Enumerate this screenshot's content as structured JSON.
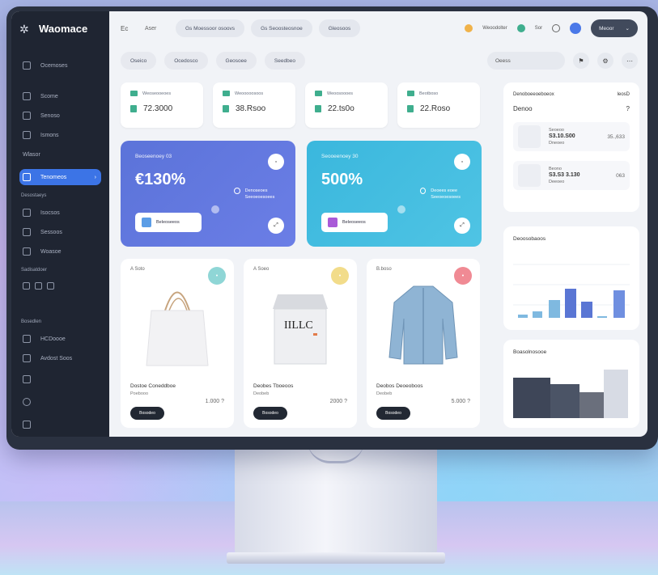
{
  "sidebar": {
    "brand": "Waomace",
    "items": [
      {
        "label": "Ocemoses"
      },
      {
        "label": "Scome"
      },
      {
        "label": "Senoso"
      },
      {
        "label": "Ismons"
      },
      {
        "label": "Wlasor"
      }
    ],
    "active_label": "Tenomeos",
    "section_1": "Desostaeys",
    "section_1_items": [
      {
        "label": "Isocsos"
      },
      {
        "label": "Sessoos"
      },
      {
        "label": "Woasoe"
      }
    ],
    "section_2": "Sadisatdoer",
    "section_3": "Bosedlen",
    "section_3_items": [
      {
        "label": "HCDoooe"
      },
      {
        "label": "Avdost Soos"
      }
    ]
  },
  "topbar": {
    "logo": "Ec",
    "title": "Aser",
    "pills": [
      "Gs Moessoor osoovs",
      "Gs Seoosteosnoe",
      "Gleosoos"
    ],
    "right_items": [
      "Weoodolter",
      "Sor"
    ],
    "user": "Meoor"
  },
  "subbar": {
    "pills": [
      "Oseico",
      "Ocedosco",
      "Geosoee",
      "Seedbeo"
    ],
    "search_placeholder": "Oeess"
  },
  "stats": [
    {
      "label": "Weoseooeoes",
      "value": "72.3000"
    },
    {
      "label": "Weooooosoos",
      "value": "38.Rsoo"
    },
    {
      "label": "Weoosoooes",
      "value": "22.ts0o"
    },
    {
      "label": "Beotboso",
      "value": "22.Roso"
    }
  ],
  "hero": [
    {
      "label": "Beoseenoey 03",
      "value": "€130%",
      "mid": "Denoseoes  Seeoeoesoees",
      "button": "Beleoseeos"
    },
    {
      "label": "Seooeenoey 30",
      "value": "500%",
      "mid": "Deoees eoee  Seeoeoesoees",
      "button": "Beleoseeos"
    }
  ],
  "products": [
    {
      "tag": "A Soto",
      "name": "Dostoe Coneddboe",
      "sub": "Poebooo",
      "price": "1.000 ?",
      "button": "Bosodeo",
      "dot_color": "#8fd6d6"
    },
    {
      "tag": "A Soeo",
      "name": "Deobes Tboeoos",
      "sub": "Deobeb",
      "price": "2000 ?",
      "button": "Bosodeo",
      "dot_color": "#f2dc8a"
    },
    {
      "tag": "B.boso",
      "name": "Deobos Deoeoboos",
      "sub": "Deobeb",
      "price": "5.000 ?",
      "button": "Bosodeo",
      "dot_color": "#f08a94"
    }
  ],
  "right_panel": {
    "title": "Denoboeeoeboeox",
    "title_right": "leosD",
    "subtitle": "Denoo",
    "subtitle_right": "?",
    "orders": [
      {
        "head": "Seoeoo",
        "main": "S3.10.S00",
        "sub": "Dneoeo",
        "amount": "35.,633"
      },
      {
        "head": "Beono",
        "main": "S3.S3 3.130",
        "sub": "Deeoeo",
        "amount": "063"
      }
    ]
  },
  "chart_panel": {
    "title": "Deoosobaoos"
  },
  "bottom_panel": {
    "title": "Boasolnosooe"
  }
}
